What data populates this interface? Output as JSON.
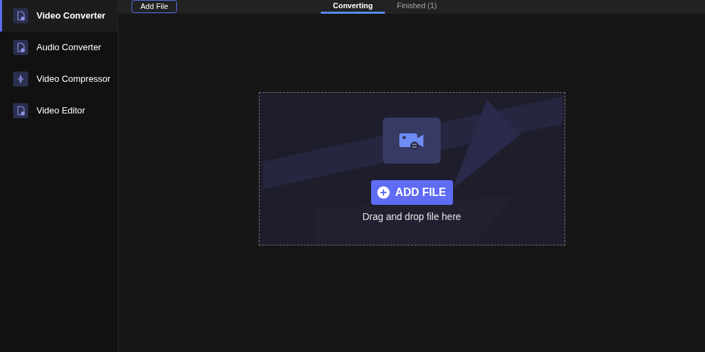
{
  "sidebar": {
    "items": [
      {
        "label": "Video Converter",
        "selected": true
      },
      {
        "label": "Audio Converter",
        "selected": false
      },
      {
        "label": "Video Compressor",
        "selected": false
      },
      {
        "label": "Video Editor",
        "selected": false
      }
    ]
  },
  "toolbar": {
    "add_button": "Add File"
  },
  "tabs": [
    {
      "label": "Converting",
      "selected": true
    },
    {
      "label": "Finished (1)",
      "selected": false
    }
  ],
  "drop_zone": {
    "button": "ADD FILE",
    "hint": "Drag and drop file here"
  }
}
